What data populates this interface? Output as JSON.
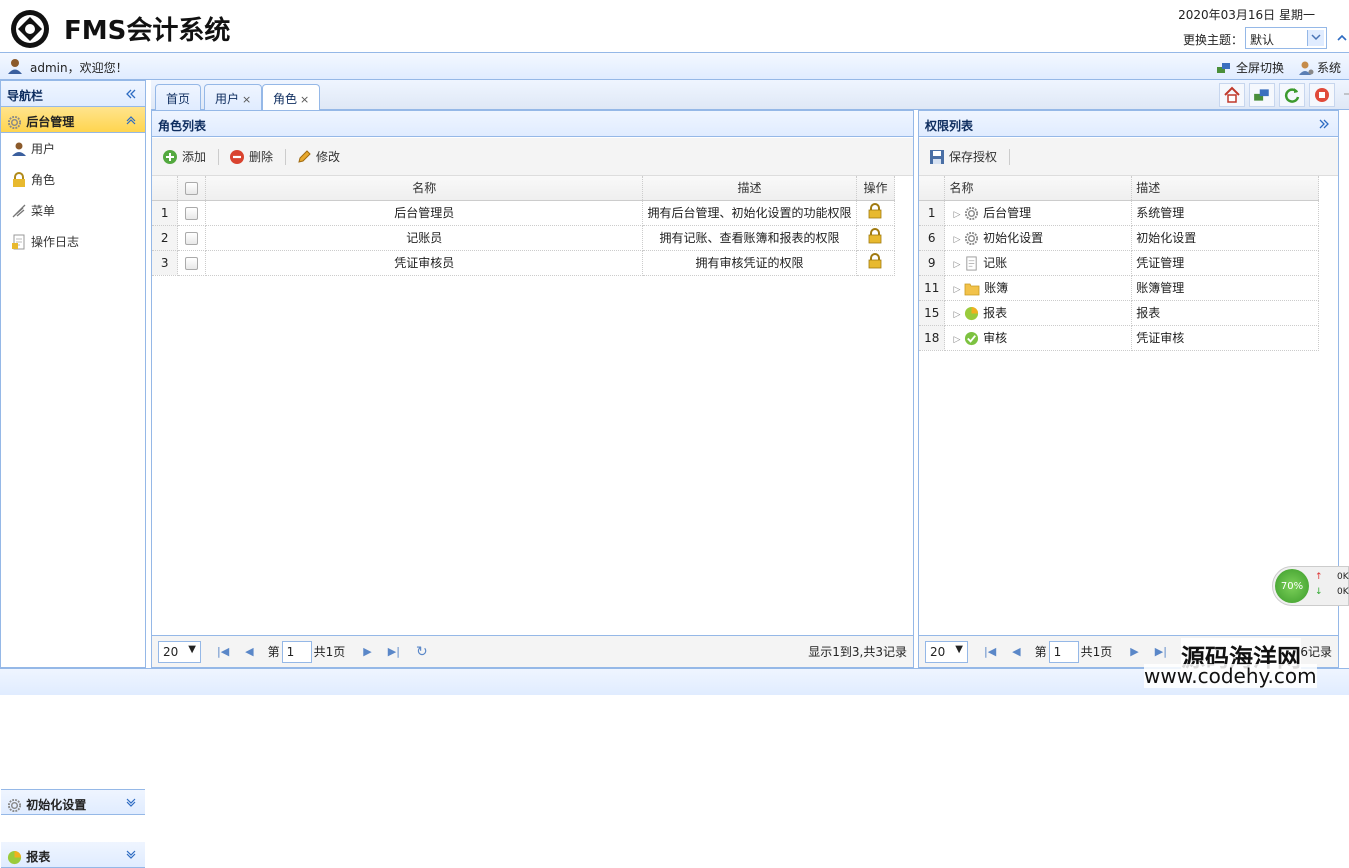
{
  "header": {
    "app_title": "FMS会计系统",
    "date": "2020年03月16日 星期一",
    "theme_label": "更换主题：",
    "theme_value": "默认"
  },
  "userbar": {
    "welcome": "admin，欢迎您！",
    "fullscreen": "全屏切换",
    "system": "系统"
  },
  "nav": {
    "title": "导航栏",
    "sections": [
      {
        "label": "后台管理",
        "items": [
          "用户",
          "角色",
          "菜单",
          "操作日志"
        ]
      },
      {
        "label": "初始化设置"
      },
      {
        "label": "报表"
      }
    ]
  },
  "tabs": [
    {
      "label": "首页"
    },
    {
      "label": "用户",
      "close": "×"
    },
    {
      "label": "角色",
      "close": "×"
    }
  ],
  "roles": {
    "title": "角色列表",
    "toolbar": {
      "add": "添加",
      "delete": "删除",
      "edit": "修改"
    },
    "columns": {
      "name": "名称",
      "desc": "描述",
      "op": "操作"
    },
    "rows": [
      {
        "n": "1",
        "name": "后台管理员",
        "desc": "拥有后台管理、初始化设置的功能权限"
      },
      {
        "n": "2",
        "name": "记账员",
        "desc": "拥有记账、查看账簿和报表的权限"
      },
      {
        "n": "3",
        "name": "凭证审核员",
        "desc": "拥有审核凭证的权限"
      }
    ],
    "pager": {
      "size": "20",
      "page_prefix": "第",
      "page": "1",
      "total_pages": "共1页",
      "info": "显示1到3,共3记录"
    }
  },
  "perms": {
    "title": "权限列表",
    "toolbar": {
      "save": "保存授权"
    },
    "columns": {
      "name": "名称",
      "desc": "描述"
    },
    "rows": [
      {
        "n": "1",
        "name": "后台管理",
        "desc": "系统管理",
        "icon": "gear-icon"
      },
      {
        "n": "6",
        "name": "初始化设置",
        "desc": "初始化设置",
        "icon": "gear-icon"
      },
      {
        "n": "9",
        "name": "记账",
        "desc": "凭证管理",
        "icon": "document-icon"
      },
      {
        "n": "11",
        "name": "账簿",
        "desc": "账簿管理",
        "icon": "folder-icon"
      },
      {
        "n": "15",
        "name": "报表",
        "desc": "报表",
        "icon": "chart-ball-icon"
      },
      {
        "n": "18",
        "name": "审核",
        "desc": "凭证审核",
        "icon": "check-ball-icon"
      }
    ],
    "pager": {
      "size": "20",
      "page_prefix": "第",
      "page": "1",
      "total_pages": "共1页",
      "info": "6记录"
    }
  },
  "widget": {
    "percent": "70%",
    "up": "0K",
    "down": "0K"
  },
  "watermark": {
    "line1": "源码海洋网",
    "line2": "www.codehy.com"
  }
}
